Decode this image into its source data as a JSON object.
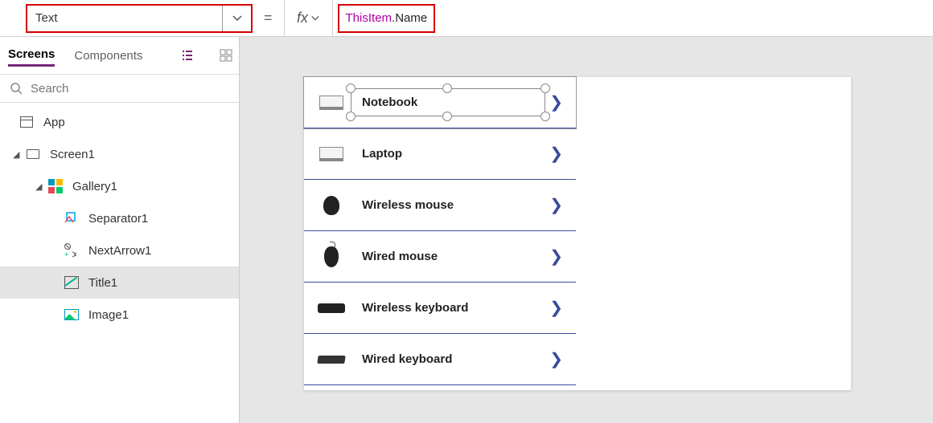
{
  "formula_bar": {
    "property": "Text",
    "equals": "=",
    "fx_label": "fx",
    "formula_this": "ThisItem",
    "formula_rest": ".Name"
  },
  "panel": {
    "tabs": {
      "screens": "Screens",
      "components": "Components"
    },
    "search_placeholder": "Search"
  },
  "tree": {
    "app": "App",
    "screen1": "Screen1",
    "gallery1": "Gallery1",
    "separator1": "Separator1",
    "nextarrow1": "NextArrow1",
    "title1": "Title1",
    "image1": "Image1"
  },
  "gallery_items": {
    "i0": "Notebook",
    "i1": "Laptop",
    "i2": "Wireless mouse",
    "i3": "Wired mouse",
    "i4": "Wireless keyboard",
    "i5": "Wired keyboard"
  }
}
